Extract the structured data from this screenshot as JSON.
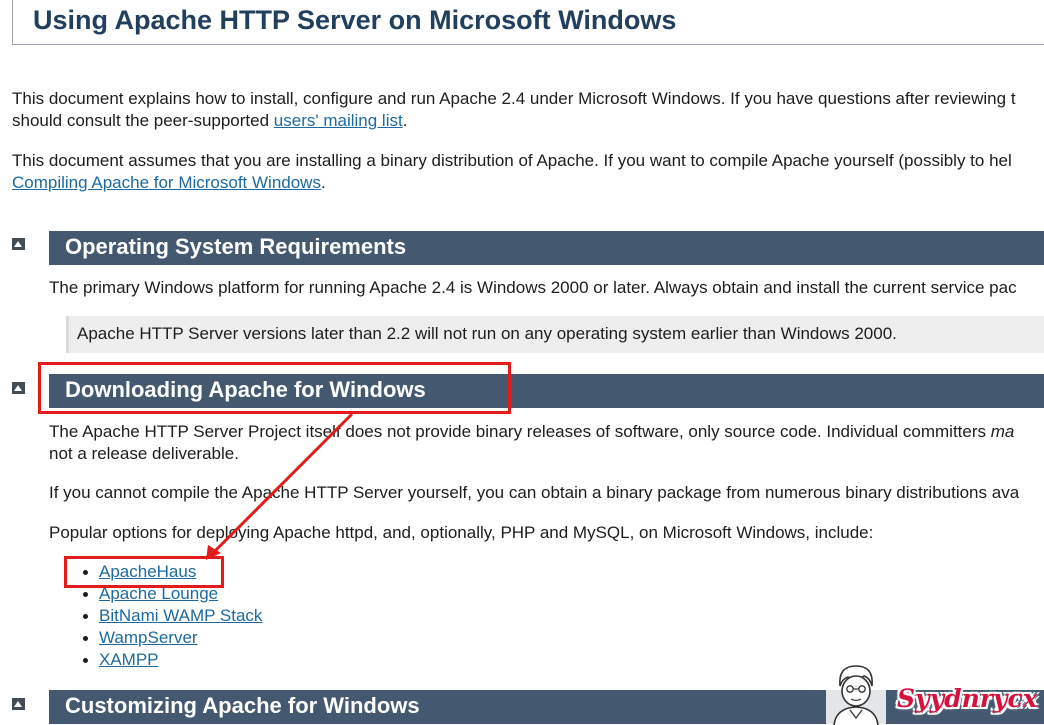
{
  "page": {
    "title": "Using Apache HTTP Server on Microsoft Windows"
  },
  "intro": {
    "p1_line1": "This document explains how to install, configure and run Apache 2.4 under Microsoft Windows. If you have questions after reviewing t",
    "p1_line2_before": "should consult the peer-supported ",
    "p1_link": "users' mailing list",
    "p1_line2_after": ".",
    "p2_line1": "This document assumes that you are installing a binary distribution of Apache. If you want to compile Apache yourself (possibly to hel",
    "p2_link": "Compiling Apache for Microsoft Windows",
    "p2_after": "."
  },
  "sections": {
    "requirements": {
      "title": "Operating System Requirements",
      "p1": "The primary Windows platform for running Apache 2.4 is Windows 2000 or later. Always obtain and install the current service pac",
      "note": "Apache HTTP Server versions later than 2.2 will not run on any operating system earlier than Windows 2000."
    },
    "downloading": {
      "title": "Downloading Apache for Windows",
      "p1_line1": "The Apache HTTP Server Project itself does not provide binary releases of software, only source code. Individual committers ",
      "p1_italic": "ma",
      "p1_line2": "not a release deliverable.",
      "p2": "If you cannot compile the Apache HTTP Server yourself, you can obtain a binary package from numerous binary distributions ava",
      "p3": "Popular options for deploying Apache httpd, and, optionally, PHP and MySQL, on Microsoft Windows, include:",
      "links": [
        "ApacheHaus",
        "Apache Lounge",
        "BitNami WAMP Stack",
        "WampServer",
        "XAMPP"
      ]
    },
    "customizing": {
      "title": "Customizing Apache for Windows"
    }
  },
  "annotations": {
    "highlight_color": "#e31b1b",
    "watermark": "Syydnrycx"
  },
  "colors": {
    "section_bar": "#44596f",
    "link": "#1e6aa0",
    "title": "#22405e"
  }
}
